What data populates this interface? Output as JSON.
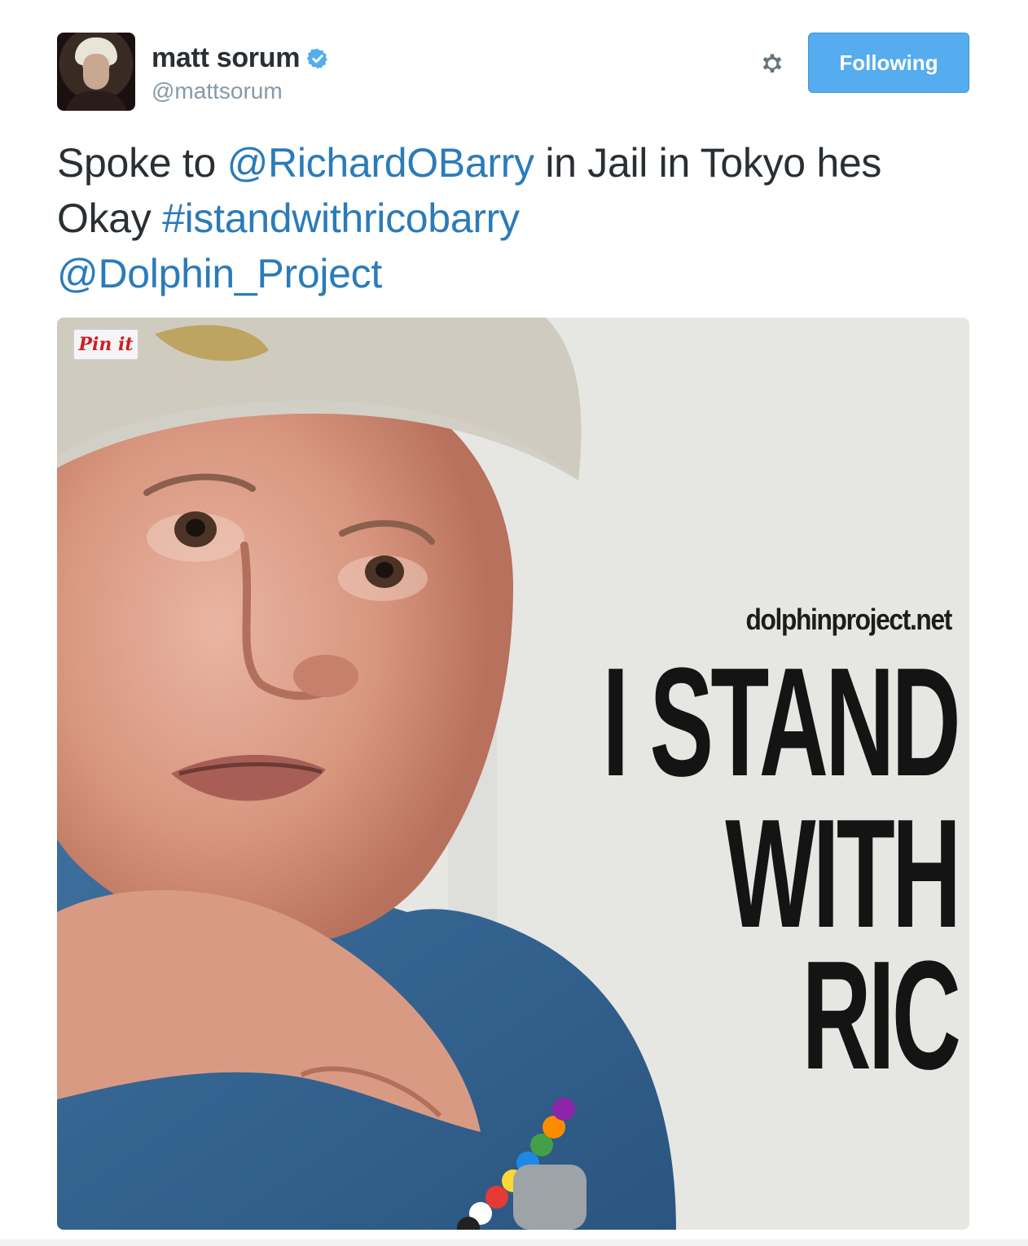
{
  "tweet": {
    "author": {
      "display_name": "matt sorum",
      "handle": "@mattsorum",
      "verified": true,
      "avatar_icon": "profile-photo"
    },
    "actions": {
      "settings_icon": "gear-icon",
      "follow_label": "Following"
    },
    "text": {
      "part1": "Spoke to ",
      "mention1": "@RichardOBarry",
      "part2": " in Jail in Tokyo hes Okay ",
      "hashtag": "#istandwithricobarry",
      "mention2": "@Dolphin_Project"
    },
    "media": {
      "pin_label": "Pin it",
      "site": "dolphinproject.net",
      "headline_line1": "I STAND",
      "headline_line2": "WITH",
      "headline_line3": "RIC"
    }
  },
  "colors": {
    "link": "#2b7bb9",
    "follow_button": "#55acee",
    "text": "#292f33",
    "muted": "#8899a6",
    "verified": "#55acee"
  }
}
